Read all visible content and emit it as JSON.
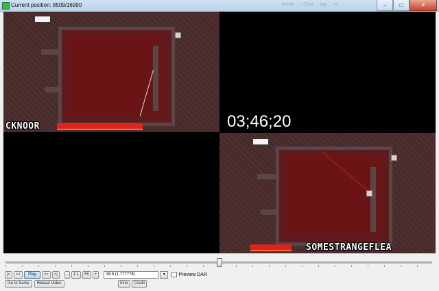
{
  "window": {
    "title": "Current position: 8509/16990",
    "background_tabs": [
      "",
      "Inhalt ... - Ciao ... ing ... ink ..."
    ],
    "controls": {
      "minimize": "–",
      "maximize": "□",
      "close": "✕"
    }
  },
  "video": {
    "players": [
      {
        "name": "CKNOOR"
      },
      {
        "name": "SOMESTRANGEFLEA"
      }
    ],
    "timer": "03;46;20",
    "lava_color": "#e0221c",
    "wall_color": "#5a4646",
    "room_color": "#6a1416"
  },
  "seek": {
    "position_fraction": 0.5009
  },
  "controls": {
    "row1": [
      "|<",
      "<<",
      "Play",
      ">>",
      ">|",
      "-",
      "1:1",
      "Fit",
      "+"
    ],
    "aspect_select": "16:9 (1.777778)",
    "preview_dar_label": "Preview DAR",
    "row2": [
      "Go to frame",
      "Reload Video"
    ],
    "row2b": [
      "Intro",
      "Credit"
    ]
  }
}
